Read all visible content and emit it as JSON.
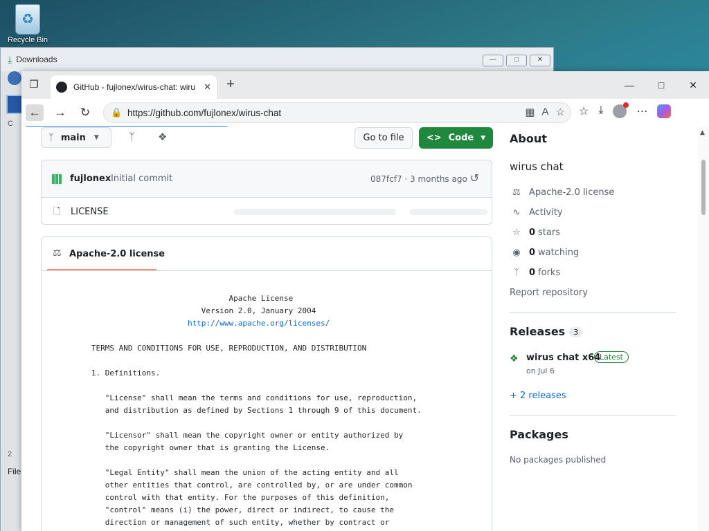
{
  "desktop": {
    "recycle_bin_label": "Recycle Bin"
  },
  "downloads_window": {
    "title": "Downloads",
    "left_labels": [
      "C",
      "2",
      "File"
    ]
  },
  "browser": {
    "tab_title": "GitHub - fujlonex/wirus-chat: wiru",
    "url": "https://github.com/fujlonex/wirus-chat"
  },
  "repo": {
    "branch": "main",
    "go_to_file": "Go to file",
    "code_button": "Code",
    "commit": {
      "author": "fujlonex",
      "message": "Initial commit",
      "meta": "087fcf7 · 3 months ago"
    },
    "files": [
      {
        "name": "LICENSE"
      }
    ],
    "license_tab": "Apache-2.0 license",
    "license_lines": [
      "                                 Apache License",
      "                           Version 2.0, January 2004",
      "                        http://www.apache.org/licenses/",
      "",
      "   TERMS AND CONDITIONS FOR USE, REPRODUCTION, AND DISTRIBUTION",
      "",
      "   1. Definitions.",
      "",
      "      \"License\" shall mean the terms and conditions for use, reproduction,",
      "      and distribution as defined by Sections 1 through 9 of this document.",
      "",
      "      \"Licensor\" shall mean the copyright owner or entity authorized by",
      "      the copyright owner that is granting the License.",
      "",
      "      \"Legal Entity\" shall mean the union of the acting entity and all",
      "      other entities that control, are controlled by, or are under common",
      "      control with that entity. For the purposes of this definition,",
      "      \"control\" means (i) the power, direct or indirect, to cause the",
      "      direction or management of such entity, whether by contract or"
    ]
  },
  "about": {
    "heading": "About",
    "description": "wirus chat",
    "license": "Apache-2.0 license",
    "activity": "Activity",
    "stars_count": "0",
    "stars_label": "stars",
    "watching_count": "0",
    "watching_label": "watching",
    "forks_count": "0",
    "forks_label": "forks",
    "report": "Report repository"
  },
  "releases": {
    "heading": "Releases",
    "count": "3",
    "latest_name": "wirus chat x64",
    "latest_badge": "Latest",
    "latest_date": "on Jul 6",
    "more_link": "+ 2 releases"
  },
  "packages": {
    "heading": "Packages",
    "empty": "No packages published"
  }
}
